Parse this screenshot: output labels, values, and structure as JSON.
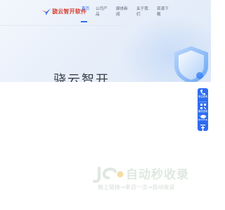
{
  "header": {
    "logo_text": "骁云智开软件",
    "nav": [
      {
        "label": "首页"
      },
      {
        "label": "公司产品"
      },
      {
        "label": "媒体新闻"
      },
      {
        "label": "关于我们"
      },
      {
        "label": "资源下载"
      }
    ],
    "active_index": 0
  },
  "hero": {
    "title": "骁云智开"
  },
  "side_panel": {
    "items": [
      {
        "label": "电话咨询",
        "icon": "phone-icon"
      },
      {
        "label": "微信咨询",
        "icon": "qrcode-icon"
      },
      {
        "label": "微信咨询",
        "icon": "chat-icon"
      }
    ],
    "top_icon": "arrow-up-icon"
  },
  "watermark": {
    "title": "自动秒收录",
    "subtitle": "做上链接→来访一次→自动收录"
  },
  "colors": {
    "accent": "#2f6cf0",
    "logo_text": "#d63a2c",
    "hero_bg": "#e8effa",
    "watermark": "#dfe8e0"
  }
}
